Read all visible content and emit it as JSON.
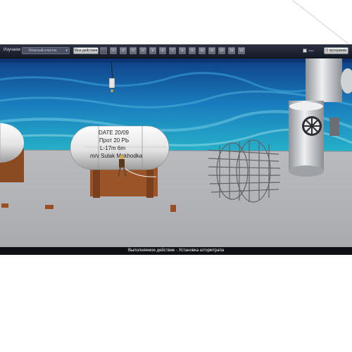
{
  "toolbar": {
    "study_label": "Изучаем",
    "mode_select": {
      "value": "Опасный участок"
    },
    "my_actions_label": "Мои действия",
    "steps": [
      "",
      "1",
      "2",
      "3",
      "4",
      "5",
      "6",
      "7",
      "8",
      "9",
      "10",
      "11",
      "12",
      "13",
      "14"
    ],
    "checkbox_label": "звук",
    "about_label": "О программе"
  },
  "scene": {
    "liferaft_text": [
      "DATE 20/09",
      "Прот 20 РЬ",
      "L-17m 6m",
      "m/v Sulak Makhodka"
    ]
  },
  "status": {
    "current_action": "Выполняемое действие - Установка штормтрапа"
  },
  "colors": {
    "toolbar_bg": "#222738",
    "sea": "#1f86b9",
    "deck": "#b7b9bc",
    "status_bg": "#0e0f14"
  }
}
